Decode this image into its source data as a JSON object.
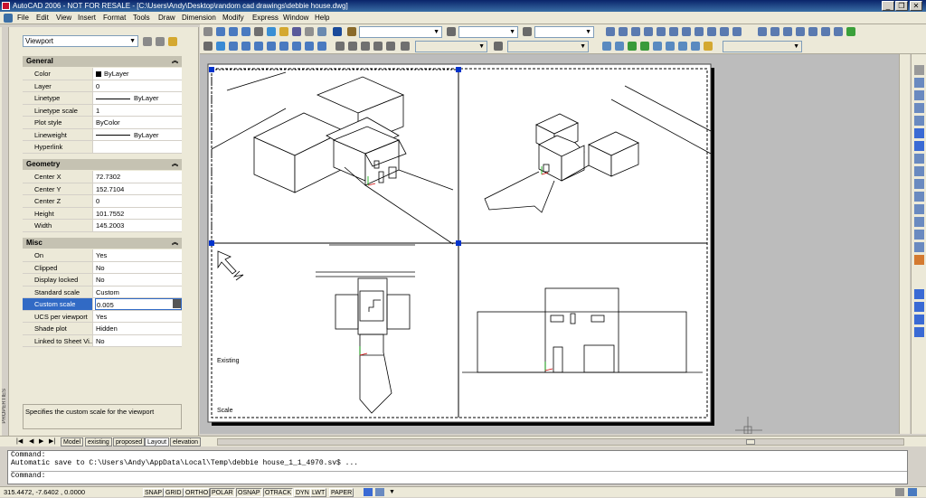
{
  "window": {
    "title": "AutoCAD 2006 - NOT FOR RESALE - [C:\\Users\\Andy\\Desktop\\random cad drawings\\debbie house.dwg]",
    "minimize": "_",
    "restore": "❐",
    "close": "✕"
  },
  "menu": [
    "File",
    "Edit",
    "View",
    "Insert",
    "Format",
    "Tools",
    "Draw",
    "Dimension",
    "Modify",
    "Express",
    "Window",
    "Help"
  ],
  "properties": {
    "selector": "Viewport",
    "sections": {
      "general": {
        "title": "General",
        "rows": [
          {
            "k": "Color",
            "v": "ByLayer"
          },
          {
            "k": "Layer",
            "v": "0"
          },
          {
            "k": "Linetype",
            "v": "ByLayer"
          },
          {
            "k": "Linetype scale",
            "v": "1"
          },
          {
            "k": "Plot style",
            "v": "ByColor"
          },
          {
            "k": "Lineweight",
            "v": "ByLayer"
          },
          {
            "k": "Hyperlink",
            "v": ""
          }
        ]
      },
      "geometry": {
        "title": "Geometry",
        "rows": [
          {
            "k": "Center X",
            "v": "72.7302"
          },
          {
            "k": "Center Y",
            "v": "152.7104"
          },
          {
            "k": "Center Z",
            "v": "0"
          },
          {
            "k": "Height",
            "v": "101.7552"
          },
          {
            "k": "Width",
            "v": "145.2003"
          }
        ]
      },
      "misc": {
        "title": "Misc",
        "rows": [
          {
            "k": "On",
            "v": "Yes"
          },
          {
            "k": "Clipped",
            "v": "No"
          },
          {
            "k": "Display locked",
            "v": "No"
          },
          {
            "k": "Standard scale",
            "v": "Custom"
          },
          {
            "k": "Custom scale",
            "v": "0.005"
          },
          {
            "k": "UCS per viewport",
            "v": "Yes"
          },
          {
            "k": "Shade plot",
            "v": "Hidden"
          },
          {
            "k": "Linked to Sheet Vi...",
            "v": "No"
          }
        ]
      }
    },
    "description": "Specifies the custom scale for the viewport",
    "palette_label": "PROPERTIES"
  },
  "drawing": {
    "label_existing": "Existing",
    "label_scale": "Scale"
  },
  "tabs": [
    "Model",
    "existing",
    "proposed",
    "Layout",
    "elevation"
  ],
  "command": {
    "line1": "Command:",
    "line2": "Automatic save to C:\\Users\\Andy\\AppData\\Local\\Temp\\debbie house_1_1_4970.sv$ ...",
    "prompt": "Command:"
  },
  "status": {
    "coords": "315.4472, -7.6402 , 0.0000",
    "toggles": [
      "SNAP",
      "GRID",
      "ORTHO",
      "POLAR",
      "OSNAP",
      "OTRACK",
      "DYN",
      "LWT",
      "PAPER"
    ]
  },
  "colors": {
    "title_start": "#0a246a",
    "selection": "#316ac5",
    "grip": "#0033cc"
  }
}
